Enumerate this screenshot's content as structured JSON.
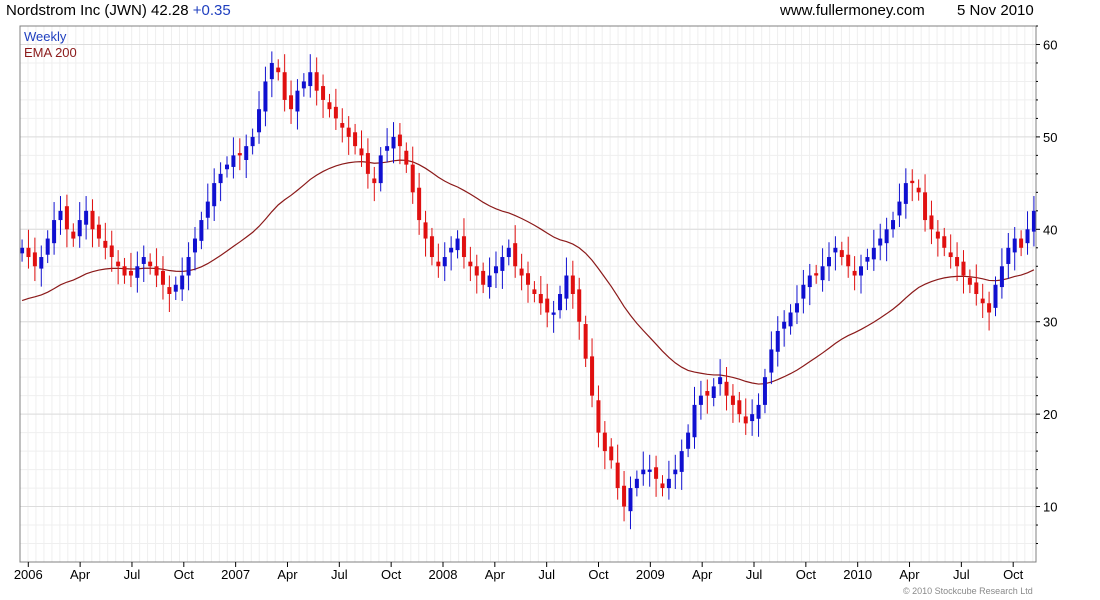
{
  "header": {
    "title": "Nordstrom Inc (JWN) 42.28",
    "change": "+0.35",
    "site": "www.fullermoney.com",
    "date": "5 Nov 2010"
  },
  "footer": {
    "copyright": "© 2010 Stockcube Research Ltd"
  },
  "colors": {
    "up": "#1010d0",
    "down": "#e01010",
    "ema": "#8b1a1a",
    "grid": "#dcdcdc",
    "frame": "#808080"
  },
  "chart_data": {
    "type": "candlestick",
    "frequency": "Weekly",
    "grid": true,
    "ylim": [
      4,
      62
    ],
    "yticks": [
      10,
      20,
      30,
      40,
      50,
      60
    ],
    "xlim": [
      2005.96,
      2010.86
    ],
    "xticks": [
      {
        "label": "2006",
        "t": 2006.0
      },
      {
        "label": "Apr",
        "t": 2006.25
      },
      {
        "label": "Jul",
        "t": 2006.5
      },
      {
        "label": "Oct",
        "t": 2006.75
      },
      {
        "label": "2007",
        "t": 2007.0
      },
      {
        "label": "Apr",
        "t": 2007.25
      },
      {
        "label": "Jul",
        "t": 2007.5
      },
      {
        "label": "Oct",
        "t": 2007.75
      },
      {
        "label": "2008",
        "t": 2008.0
      },
      {
        "label": "Apr",
        "t": 2008.25
      },
      {
        "label": "Jul",
        "t": 2008.5
      },
      {
        "label": "Oct",
        "t": 2008.75
      },
      {
        "label": "2009",
        "t": 2009.0
      },
      {
        "label": "Apr",
        "t": 2009.25
      },
      {
        "label": "Jul",
        "t": 2009.5
      },
      {
        "label": "Oct",
        "t": 2009.75
      },
      {
        "label": "2010",
        "t": 2010.0
      },
      {
        "label": "Apr",
        "t": 2010.25
      },
      {
        "label": "Jul",
        "t": 2010.5
      },
      {
        "label": "Oct",
        "t": 2010.75
      }
    ],
    "legend": [
      {
        "name": "Weekly",
        "color": "#1f3fbf"
      },
      {
        "name": "EMA 200",
        "color": "#8b1a1a"
      }
    ],
    "closes": [
      38,
      37,
      36,
      37,
      39,
      41,
      42,
      40,
      39,
      41,
      42,
      40,
      39,
      38,
      37,
      36,
      35,
      35,
      36,
      37,
      36,
      35,
      34,
      33,
      34,
      35,
      37,
      39,
      41,
      43,
      45,
      46,
      47,
      48,
      48,
      49,
      50,
      53,
      56,
      58,
      57,
      54,
      53,
      55,
      56,
      57,
      55,
      54,
      53,
      52,
      51,
      50,
      49,
      48,
      46,
      45,
      48,
      49,
      50,
      49,
      47,
      44,
      41,
      39,
      37,
      36,
      37,
      38,
      39,
      37,
      36,
      35,
      34,
      35,
      36,
      37,
      38,
      36,
      35,
      34,
      33,
      32,
      31,
      31,
      33,
      35,
      33,
      30,
      26,
      22,
      18,
      16,
      15,
      12,
      10,
      12,
      13,
      14,
      14,
      13,
      12,
      13,
      14,
      16,
      18,
      21,
      22,
      22,
      23,
      24,
      22,
      21,
      20,
      19,
      20,
      21,
      24,
      27,
      29,
      30,
      31,
      32,
      34,
      35,
      35,
      36,
      37,
      38,
      37,
      36,
      35,
      36,
      37,
      38,
      39,
      40,
      41,
      43,
      45,
      45,
      44,
      41,
      40,
      39,
      38,
      37,
      36,
      35,
      34,
      33,
      32,
      31,
      34,
      36,
      38,
      39,
      38,
      40,
      42
    ]
  }
}
